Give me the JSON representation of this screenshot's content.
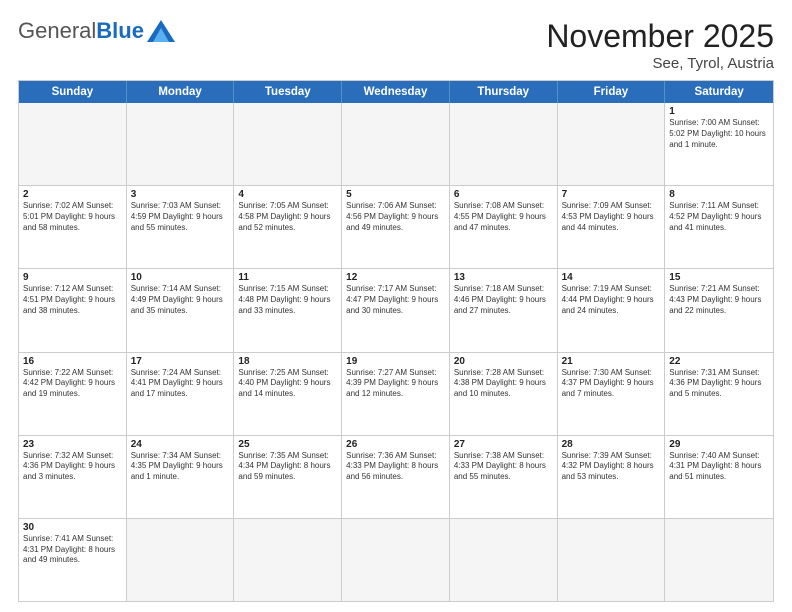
{
  "header": {
    "logo": {
      "general": "General",
      "blue": "Blue"
    },
    "month": "November 2025",
    "location": "See, Tyrol, Austria"
  },
  "weekdays": [
    "Sunday",
    "Monday",
    "Tuesday",
    "Wednesday",
    "Thursday",
    "Friday",
    "Saturday"
  ],
  "rows": [
    [
      {
        "day": "",
        "info": ""
      },
      {
        "day": "",
        "info": ""
      },
      {
        "day": "",
        "info": ""
      },
      {
        "day": "",
        "info": ""
      },
      {
        "day": "",
        "info": ""
      },
      {
        "day": "",
        "info": ""
      },
      {
        "day": "1",
        "info": "Sunrise: 7:00 AM\nSunset: 5:02 PM\nDaylight: 10 hours and 1 minute."
      }
    ],
    [
      {
        "day": "2",
        "info": "Sunrise: 7:02 AM\nSunset: 5:01 PM\nDaylight: 9 hours and 58 minutes."
      },
      {
        "day": "3",
        "info": "Sunrise: 7:03 AM\nSunset: 4:59 PM\nDaylight: 9 hours and 55 minutes."
      },
      {
        "day": "4",
        "info": "Sunrise: 7:05 AM\nSunset: 4:58 PM\nDaylight: 9 hours and 52 minutes."
      },
      {
        "day": "5",
        "info": "Sunrise: 7:06 AM\nSunset: 4:56 PM\nDaylight: 9 hours and 49 minutes."
      },
      {
        "day": "6",
        "info": "Sunrise: 7:08 AM\nSunset: 4:55 PM\nDaylight: 9 hours and 47 minutes."
      },
      {
        "day": "7",
        "info": "Sunrise: 7:09 AM\nSunset: 4:53 PM\nDaylight: 9 hours and 44 minutes."
      },
      {
        "day": "8",
        "info": "Sunrise: 7:11 AM\nSunset: 4:52 PM\nDaylight: 9 hours and 41 minutes."
      }
    ],
    [
      {
        "day": "9",
        "info": "Sunrise: 7:12 AM\nSunset: 4:51 PM\nDaylight: 9 hours and 38 minutes."
      },
      {
        "day": "10",
        "info": "Sunrise: 7:14 AM\nSunset: 4:49 PM\nDaylight: 9 hours and 35 minutes."
      },
      {
        "day": "11",
        "info": "Sunrise: 7:15 AM\nSunset: 4:48 PM\nDaylight: 9 hours and 33 minutes."
      },
      {
        "day": "12",
        "info": "Sunrise: 7:17 AM\nSunset: 4:47 PM\nDaylight: 9 hours and 30 minutes."
      },
      {
        "day": "13",
        "info": "Sunrise: 7:18 AM\nSunset: 4:46 PM\nDaylight: 9 hours and 27 minutes."
      },
      {
        "day": "14",
        "info": "Sunrise: 7:19 AM\nSunset: 4:44 PM\nDaylight: 9 hours and 24 minutes."
      },
      {
        "day": "15",
        "info": "Sunrise: 7:21 AM\nSunset: 4:43 PM\nDaylight: 9 hours and 22 minutes."
      }
    ],
    [
      {
        "day": "16",
        "info": "Sunrise: 7:22 AM\nSunset: 4:42 PM\nDaylight: 9 hours and 19 minutes."
      },
      {
        "day": "17",
        "info": "Sunrise: 7:24 AM\nSunset: 4:41 PM\nDaylight: 9 hours and 17 minutes."
      },
      {
        "day": "18",
        "info": "Sunrise: 7:25 AM\nSunset: 4:40 PM\nDaylight: 9 hours and 14 minutes."
      },
      {
        "day": "19",
        "info": "Sunrise: 7:27 AM\nSunset: 4:39 PM\nDaylight: 9 hours and 12 minutes."
      },
      {
        "day": "20",
        "info": "Sunrise: 7:28 AM\nSunset: 4:38 PM\nDaylight: 9 hours and 10 minutes."
      },
      {
        "day": "21",
        "info": "Sunrise: 7:30 AM\nSunset: 4:37 PM\nDaylight: 9 hours and 7 minutes."
      },
      {
        "day": "22",
        "info": "Sunrise: 7:31 AM\nSunset: 4:36 PM\nDaylight: 9 hours and 5 minutes."
      }
    ],
    [
      {
        "day": "23",
        "info": "Sunrise: 7:32 AM\nSunset: 4:36 PM\nDaylight: 9 hours and 3 minutes."
      },
      {
        "day": "24",
        "info": "Sunrise: 7:34 AM\nSunset: 4:35 PM\nDaylight: 9 hours and 1 minute."
      },
      {
        "day": "25",
        "info": "Sunrise: 7:35 AM\nSunset: 4:34 PM\nDaylight: 8 hours and 59 minutes."
      },
      {
        "day": "26",
        "info": "Sunrise: 7:36 AM\nSunset: 4:33 PM\nDaylight: 8 hours and 56 minutes."
      },
      {
        "day": "27",
        "info": "Sunrise: 7:38 AM\nSunset: 4:33 PM\nDaylight: 8 hours and 55 minutes."
      },
      {
        "day": "28",
        "info": "Sunrise: 7:39 AM\nSunset: 4:32 PM\nDaylight: 8 hours and 53 minutes."
      },
      {
        "day": "29",
        "info": "Sunrise: 7:40 AM\nSunset: 4:31 PM\nDaylight: 8 hours and 51 minutes."
      }
    ],
    [
      {
        "day": "30",
        "info": "Sunrise: 7:41 AM\nSunset: 4:31 PM\nDaylight: 8 hours and 49 minutes."
      },
      {
        "day": "",
        "info": ""
      },
      {
        "day": "",
        "info": ""
      },
      {
        "day": "",
        "info": ""
      },
      {
        "day": "",
        "info": ""
      },
      {
        "day": "",
        "info": ""
      },
      {
        "day": "",
        "info": ""
      }
    ]
  ]
}
